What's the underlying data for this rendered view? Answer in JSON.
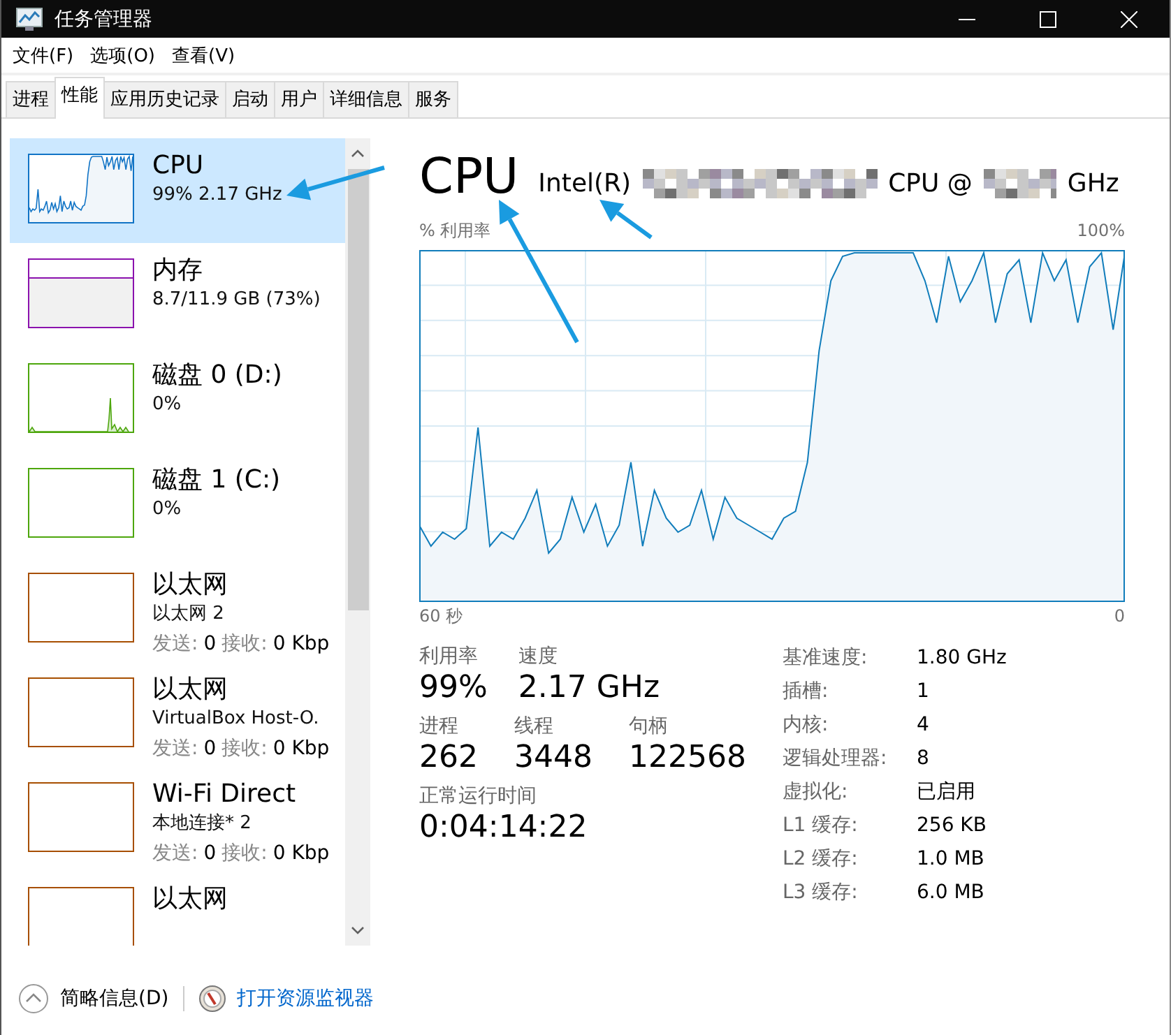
{
  "window": {
    "title": "任务管理器"
  },
  "menu": [
    "文件(F)",
    "选项(O)",
    "查看(V)"
  ],
  "tabs": [
    {
      "label": "进程",
      "selected": false
    },
    {
      "label": "性能",
      "selected": true
    },
    {
      "label": "应用历史记录",
      "selected": false
    },
    {
      "label": "启动",
      "selected": false
    },
    {
      "label": "用户",
      "selected": false
    },
    {
      "label": "详细信息",
      "selected": false
    },
    {
      "label": "服务",
      "selected": false
    }
  ],
  "sidebar": {
    "items": [
      {
        "kind": "cpu",
        "name": "CPU",
        "detail": "99% 2.17 GHz",
        "color": "#1174c6",
        "selected": true
      },
      {
        "kind": "memory",
        "name": "内存",
        "detail": "8.7/11.9 GB (73%)",
        "color": "#8b12ae",
        "selected": false
      },
      {
        "kind": "disk",
        "name": "磁盘 0 (D:)",
        "detail": "0%",
        "color": "#4da60c",
        "activity": true,
        "selected": false
      },
      {
        "kind": "disk",
        "name": "磁盘 1 (C:)",
        "detail": "0%",
        "color": "#4da60c",
        "activity": false,
        "selected": false
      },
      {
        "kind": "network",
        "name": "以太网",
        "detail": "以太网 2",
        "traffic": [
          {
            "text": "发送:",
            "muted": true
          },
          {
            "text": "0",
            "muted": false
          },
          {
            "text": "接收:",
            "muted": true
          },
          {
            "text": "0 Kbp",
            "muted": false
          }
        ],
        "color": "#a74f01",
        "selected": false
      },
      {
        "kind": "network",
        "name": "以太网",
        "detail": "VirtualBox Host-O.",
        "traffic": [
          {
            "text": "发送:",
            "muted": true
          },
          {
            "text": "0",
            "muted": false
          },
          {
            "text": "接收:",
            "muted": true
          },
          {
            "text": "0 Kbp",
            "muted": false
          }
        ],
        "color": "#a74f01",
        "selected": false
      },
      {
        "kind": "network",
        "name": "Wi-Fi Direct",
        "detail": "本地连接* 2",
        "traffic": [
          {
            "text": "发送:",
            "muted": true
          },
          {
            "text": "0",
            "muted": false
          },
          {
            "text": "接收:",
            "muted": true
          },
          {
            "text": "0 Kbp",
            "muted": false
          }
        ],
        "color": "#a74f01",
        "selected": false
      },
      {
        "kind": "network",
        "name": "以太网",
        "color": "#a74f01",
        "selected": false
      }
    ]
  },
  "performance": {
    "heading": "CPU",
    "model": [
      {
        "kind": "text",
        "text": "Intel(R)"
      },
      {
        "kind": "redacted"
      },
      {
        "kind": "text",
        "text": "CPU @"
      },
      {
        "kind": "redacted"
      },
      {
        "kind": "text",
        "text": "GHz"
      }
    ],
    "graph": {
      "ylabel": "% 利用率",
      "top_label": "100%",
      "start_label": "60 秒",
      "end_label": "0"
    },
    "primary_stats": [
      [
        {
          "label": "利用率",
          "value": "99%"
        },
        {
          "label": "速度",
          "value": "2.17 GHz"
        }
      ],
      [
        {
          "label": "进程",
          "value": "262"
        },
        {
          "label": "线程",
          "value": "3448"
        },
        {
          "label": "句柄",
          "value": "122568"
        }
      ],
      [
        {
          "label": "正常运行时间",
          "value": "0:04:14:22"
        }
      ]
    ],
    "details": [
      {
        "label": "基准速度:",
        "value": "1.80 GHz"
      },
      {
        "label": "插槽:",
        "value": "1"
      },
      {
        "label": "内核:",
        "value": "4"
      },
      {
        "label": "逻辑处理器:",
        "value": "8"
      },
      {
        "label": "虚拟化:",
        "value": "已启用"
      },
      {
        "label": "L1 缓存:",
        "value": "256 KB"
      },
      {
        "label": "L2 缓存:",
        "value": "1.0 MB"
      },
      {
        "label": "L3 缓存:",
        "value": "6.0 MB"
      }
    ]
  },
  "footer": {
    "collapse": "简略信息(D)",
    "monitor_link": "打开资源监视器"
  },
  "annotation_arrows": [
    {
      "kind": "arrow"
    },
    {
      "kind": "arrow"
    },
    {
      "kind": "arrow"
    }
  ]
}
